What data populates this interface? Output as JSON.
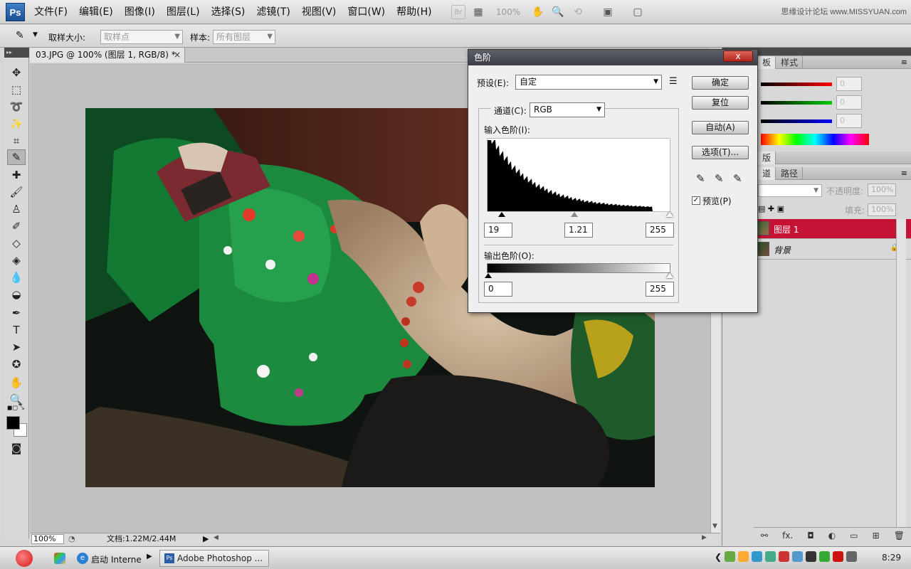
{
  "app": {
    "logo": "Ps",
    "brand": "思缘设计论坛 www.MISSYUAN.com"
  },
  "menu": [
    "文件(F)",
    "编辑(E)",
    "图像(I)",
    "图层(L)",
    "选择(S)",
    "滤镜(T)",
    "视图(V)",
    "窗口(W)",
    "帮助(H)"
  ],
  "menu_tools": {
    "bridge": "Br",
    "zoom": "100%"
  },
  "options": {
    "sample_size_label": "取样大小:",
    "sample_size_value": "取样点",
    "sample_label": "样本:",
    "sample_value": "所有图层"
  },
  "document": {
    "tab_title": "03.JPG @ 100% (图层 1, RGB/8) *",
    "close": "×",
    "zoom": "100%",
    "doc_size": "文档:1.22M/2.44M"
  },
  "panels": {
    "color_tabs": [
      "板",
      "样式"
    ],
    "color_values": [
      "0",
      "0",
      "0"
    ],
    "swatch_tab": "版",
    "layers_tabs": [
      "道",
      "路径"
    ],
    "opacity_label": "不透明度:",
    "opacity_value": "100%",
    "fill_label": "填充:",
    "fill_value": "100%",
    "layers": [
      {
        "name": "图层 1",
        "selected": true
      },
      {
        "name": "背景",
        "selected": false,
        "locked": true
      }
    ],
    "footer": [
      "⚯",
      "fx.",
      "◘",
      "◐",
      "▭",
      "⊞",
      "🗑"
    ]
  },
  "levels_dialog": {
    "title": "色阶",
    "close": "x",
    "preset_label": "预设(E):",
    "preset_value": "自定",
    "channel_label": "通道(C):",
    "channel_value": "RGB",
    "input_label": "输入色阶(I):",
    "input_black": "19",
    "input_gamma": "1.21",
    "input_white": "255",
    "output_label": "输出色阶(O):",
    "output_black": "0",
    "output_white": "255",
    "buttons": {
      "ok": "确定",
      "reset": "复位",
      "auto": "自动(A)",
      "options": "选项(T)..."
    },
    "preview_label": "预览(P)",
    "preview_checked": true
  },
  "taskbar": {
    "start_label": "启动 Interne",
    "ps_task": "Adobe Photoshop ...",
    "clock": "8:29"
  },
  "colors": {
    "selected_layer": "#c51336",
    "title_bar": "#4a4c55"
  }
}
